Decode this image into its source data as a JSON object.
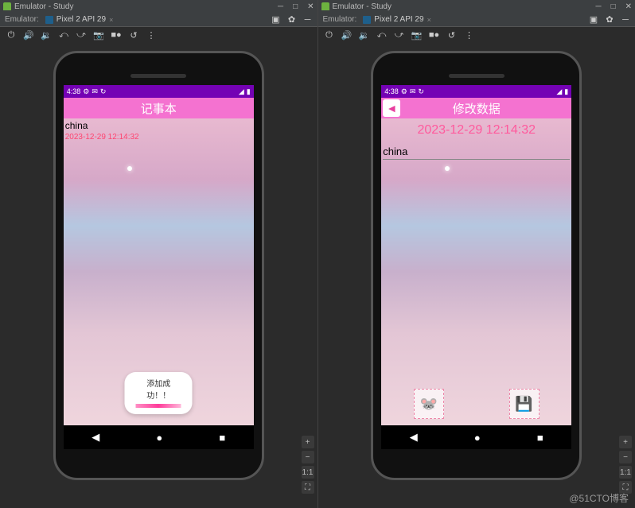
{
  "window": {
    "title": "Emulator - Study"
  },
  "emulatorLabel": "Emulator:",
  "tab": {
    "label": "Pixel 2 API 29"
  },
  "phone1": {
    "statusTime": "4:38",
    "appTitle": "记事本",
    "item": {
      "text": "china",
      "date": "2023-12-29 12:14:32"
    },
    "toast": "添加成功！！"
  },
  "phone2": {
    "statusTime": "4:38",
    "appTitle": "修改数据",
    "timestamp": "2023-12-29 12:14:32",
    "field": "china"
  },
  "watermark": "@51CTO博客"
}
